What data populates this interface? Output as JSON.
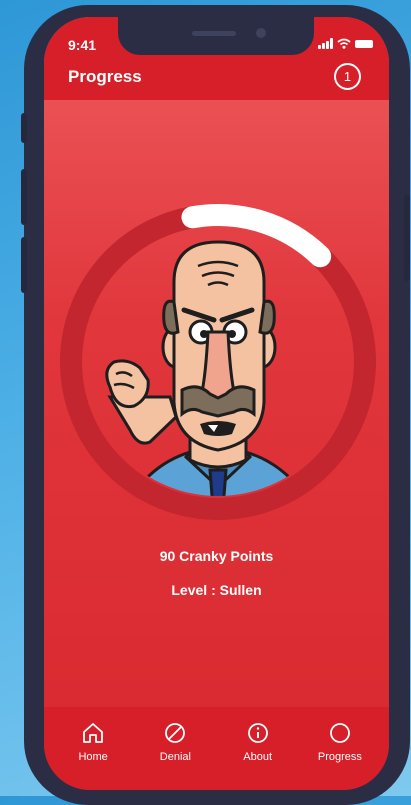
{
  "status_bar": {
    "time": "9:41"
  },
  "header": {
    "title": "Progress",
    "badge_count": "1"
  },
  "progress": {
    "points_text": "90 Cranky Points",
    "level_text": "Level : Sullen",
    "ring_fraction": 0.15
  },
  "colors": {
    "accent": "#d71f29",
    "ring_track": "#c3262e",
    "ring_progress": "#ffffff",
    "phone_frame": "#2b2d45"
  },
  "tabbar": {
    "items": [
      {
        "label": "Home",
        "icon": "home-icon"
      },
      {
        "label": "Denial",
        "icon": "denial-icon"
      },
      {
        "label": "About",
        "icon": "info-icon"
      },
      {
        "label": "Progress",
        "icon": "circle-icon"
      }
    ]
  }
}
